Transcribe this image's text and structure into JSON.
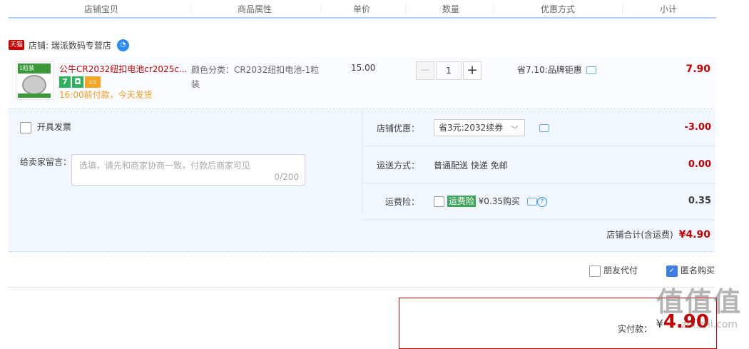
{
  "header": {
    "col_shop": "店铺宝贝",
    "col_props": "商品属性",
    "col_price": "单价",
    "col_qty": "数量",
    "col_promo": "优惠方式",
    "col_subtotal": "小计"
  },
  "shop": {
    "badge": "天猫",
    "name": "店铺: 瑞派数码专营店"
  },
  "item": {
    "thumb_label": "1粒装",
    "title": "公牛CR2032纽扣电池cr2025c...",
    "badge1": "7",
    "badge2": "",
    "delivery": "16:00前付款，今天发货",
    "props": "颜色分类：CR2032纽扣电池-1粒装",
    "price": "15.00",
    "qty_minus": "−",
    "qty": "1",
    "qty_plus": "+",
    "promo": "省7.10:品牌钜惠",
    "subtotal": "7.90"
  },
  "options": {
    "invoice_label": "开具发票",
    "memo_label": "给卖家留言：",
    "memo_placeholder": "选填，请先和商家协商一致，付款后商家可见",
    "memo_count": "0/200",
    "coupon_label": "店铺优惠：",
    "coupon_value": "省3元:2032续券",
    "coupon_amount": "-3.00",
    "shipping_label": "运送方式：",
    "shipping_value": "普通配送 快递 免邮",
    "shipping_amount": "0.00",
    "insurance_label": "运费险：",
    "insurance_tag": "运费险",
    "insurance_value": "¥0.35购买",
    "insurance_amount": "0.35",
    "total_label": "店铺合计(含运费)",
    "total_value": "¥4.90"
  },
  "bottom": {
    "friend_pay": "朋友代付",
    "anon_buy": "匿名购买"
  },
  "pay": {
    "label": "实付款：",
    "currency": "¥",
    "amount": "4.90"
  },
  "watermark": {
    "mark": "值值值",
    "site": "zhi.zhi.com"
  },
  "colors": {
    "accent_red": "#c40000",
    "accent_blue": "#3d7ee4",
    "row_bg": "#f2f7ff"
  }
}
